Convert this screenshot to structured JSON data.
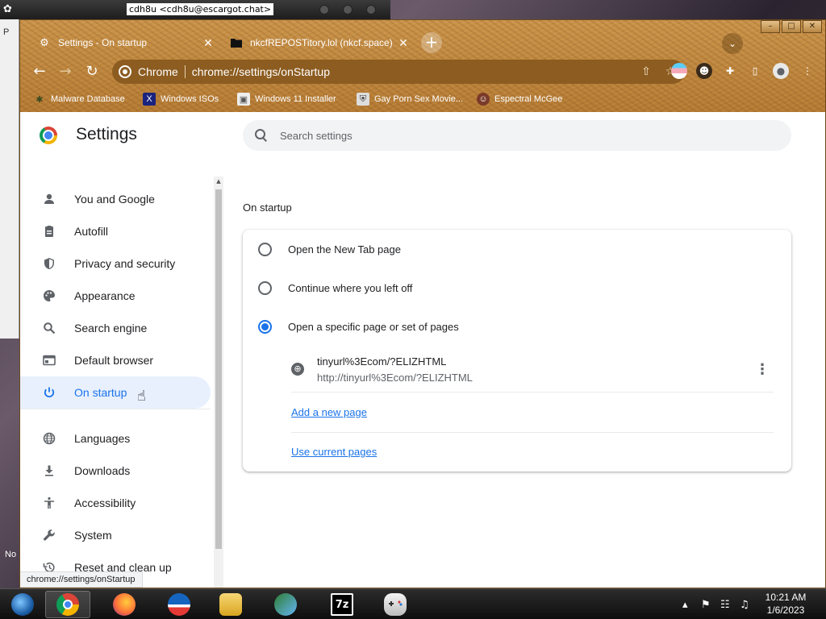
{
  "desktop": {
    "messenger_title": "cdh8u <cdh8u@escargot.chat>",
    "behind_window_letter": "P",
    "side_text": "No"
  },
  "browser": {
    "window_controls": {
      "minimize": "–",
      "maximize": "□",
      "close": "✕"
    },
    "tabs": [
      {
        "title": "Settings - On startup",
        "icon": "gear-icon",
        "active": true
      },
      {
        "title": "nkcfREPOSTitory.lol (nkcf.space)",
        "icon": "folder-icon",
        "active": false
      }
    ],
    "tab_close_glyph": "✕",
    "new_tab_glyph": "+",
    "tab_search_glyph": "⌄",
    "toolbar": {
      "back_glyph": "←",
      "forward_glyph": "→",
      "reload_glyph": "↻",
      "site_chip": "Chrome",
      "url": "chrome://settings/onStartup",
      "share_glyph": "⇧",
      "bookmark_glyph": "☆"
    },
    "bookmarks": [
      {
        "label": "Malware Database",
        "icon": "bug-icon"
      },
      {
        "label": "Windows ISOs",
        "icon": "x-logo-icon"
      },
      {
        "label": "Windows 11 Installer",
        "icon": "image-icon"
      },
      {
        "label": "Gay Porn Sex Movie...",
        "icon": "shield-icon"
      },
      {
        "label": "Espectral McGee",
        "icon": "avatar-icon"
      }
    ]
  },
  "settings": {
    "title": "Settings",
    "search_placeholder": "Search settings",
    "sidebar": [
      {
        "label": "You and Google",
        "icon": "person-icon",
        "glyph": "●",
        "selected": false
      },
      {
        "label": "Autofill",
        "icon": "clipboard-icon",
        "glyph": "▤",
        "selected": false
      },
      {
        "label": "Privacy and security",
        "icon": "shield-icon",
        "glyph": "⛨",
        "selected": false
      },
      {
        "label": "Appearance",
        "icon": "palette-icon",
        "glyph": "◐",
        "selected": false
      },
      {
        "label": "Search engine",
        "icon": "search-icon",
        "glyph": "⌕",
        "selected": false
      },
      {
        "label": "Default browser",
        "icon": "browser-icon",
        "glyph": "▭",
        "selected": false
      },
      {
        "label": "On startup",
        "icon": "power-icon",
        "glyph": "⏻",
        "selected": true
      },
      {
        "label": "Languages",
        "icon": "globe-icon",
        "glyph": "⊕",
        "selected": false
      },
      {
        "label": "Downloads",
        "icon": "download-icon",
        "glyph": "⤓",
        "selected": false
      },
      {
        "label": "Accessibility",
        "icon": "accessibility-icon",
        "glyph": "†",
        "selected": false
      },
      {
        "label": "System",
        "icon": "wrench-icon",
        "glyph": "⚒",
        "selected": false
      },
      {
        "label": "Reset and clean up",
        "icon": "history-icon",
        "glyph": "⟲",
        "selected": false
      }
    ],
    "section_title": "On startup",
    "startup_options": [
      {
        "label": "Open the New Tab page",
        "checked": false
      },
      {
        "label": "Continue where you left off",
        "checked": false
      },
      {
        "label": "Open a specific page or set of pages",
        "checked": true
      }
    ],
    "startup_page": {
      "title": "tinyurl%3Ecom/?ELIZHTML",
      "url": "http://tinyurl%3Ecom/?ELIZHTML",
      "more_glyph": "⋮"
    },
    "add_page_link": "Add a new page",
    "use_current_link": "Use current pages",
    "status_url": "chrome://settings/onStartup"
  },
  "taskbar": {
    "apps": [
      {
        "name": "start-button",
        "label": ""
      },
      {
        "name": "chrome",
        "label": ""
      },
      {
        "name": "firefox",
        "label": ""
      },
      {
        "name": "obama-app",
        "label": ""
      },
      {
        "name": "file-explorer",
        "label": ""
      },
      {
        "name": "messenger",
        "label": ""
      },
      {
        "name": "7zip",
        "label": "7z"
      },
      {
        "name": "gamepad",
        "label": ""
      }
    ],
    "tray_chevron": "▴",
    "tray_flag": "⚑",
    "tray_network": "☷",
    "tray_volume": "♫",
    "time": "10:21 AM",
    "date": "1/6/2023"
  },
  "colors": {
    "accent": "#1a73e8",
    "titlebar_theme": "#b9823a",
    "selected_bg": "#e8f0fe"
  }
}
